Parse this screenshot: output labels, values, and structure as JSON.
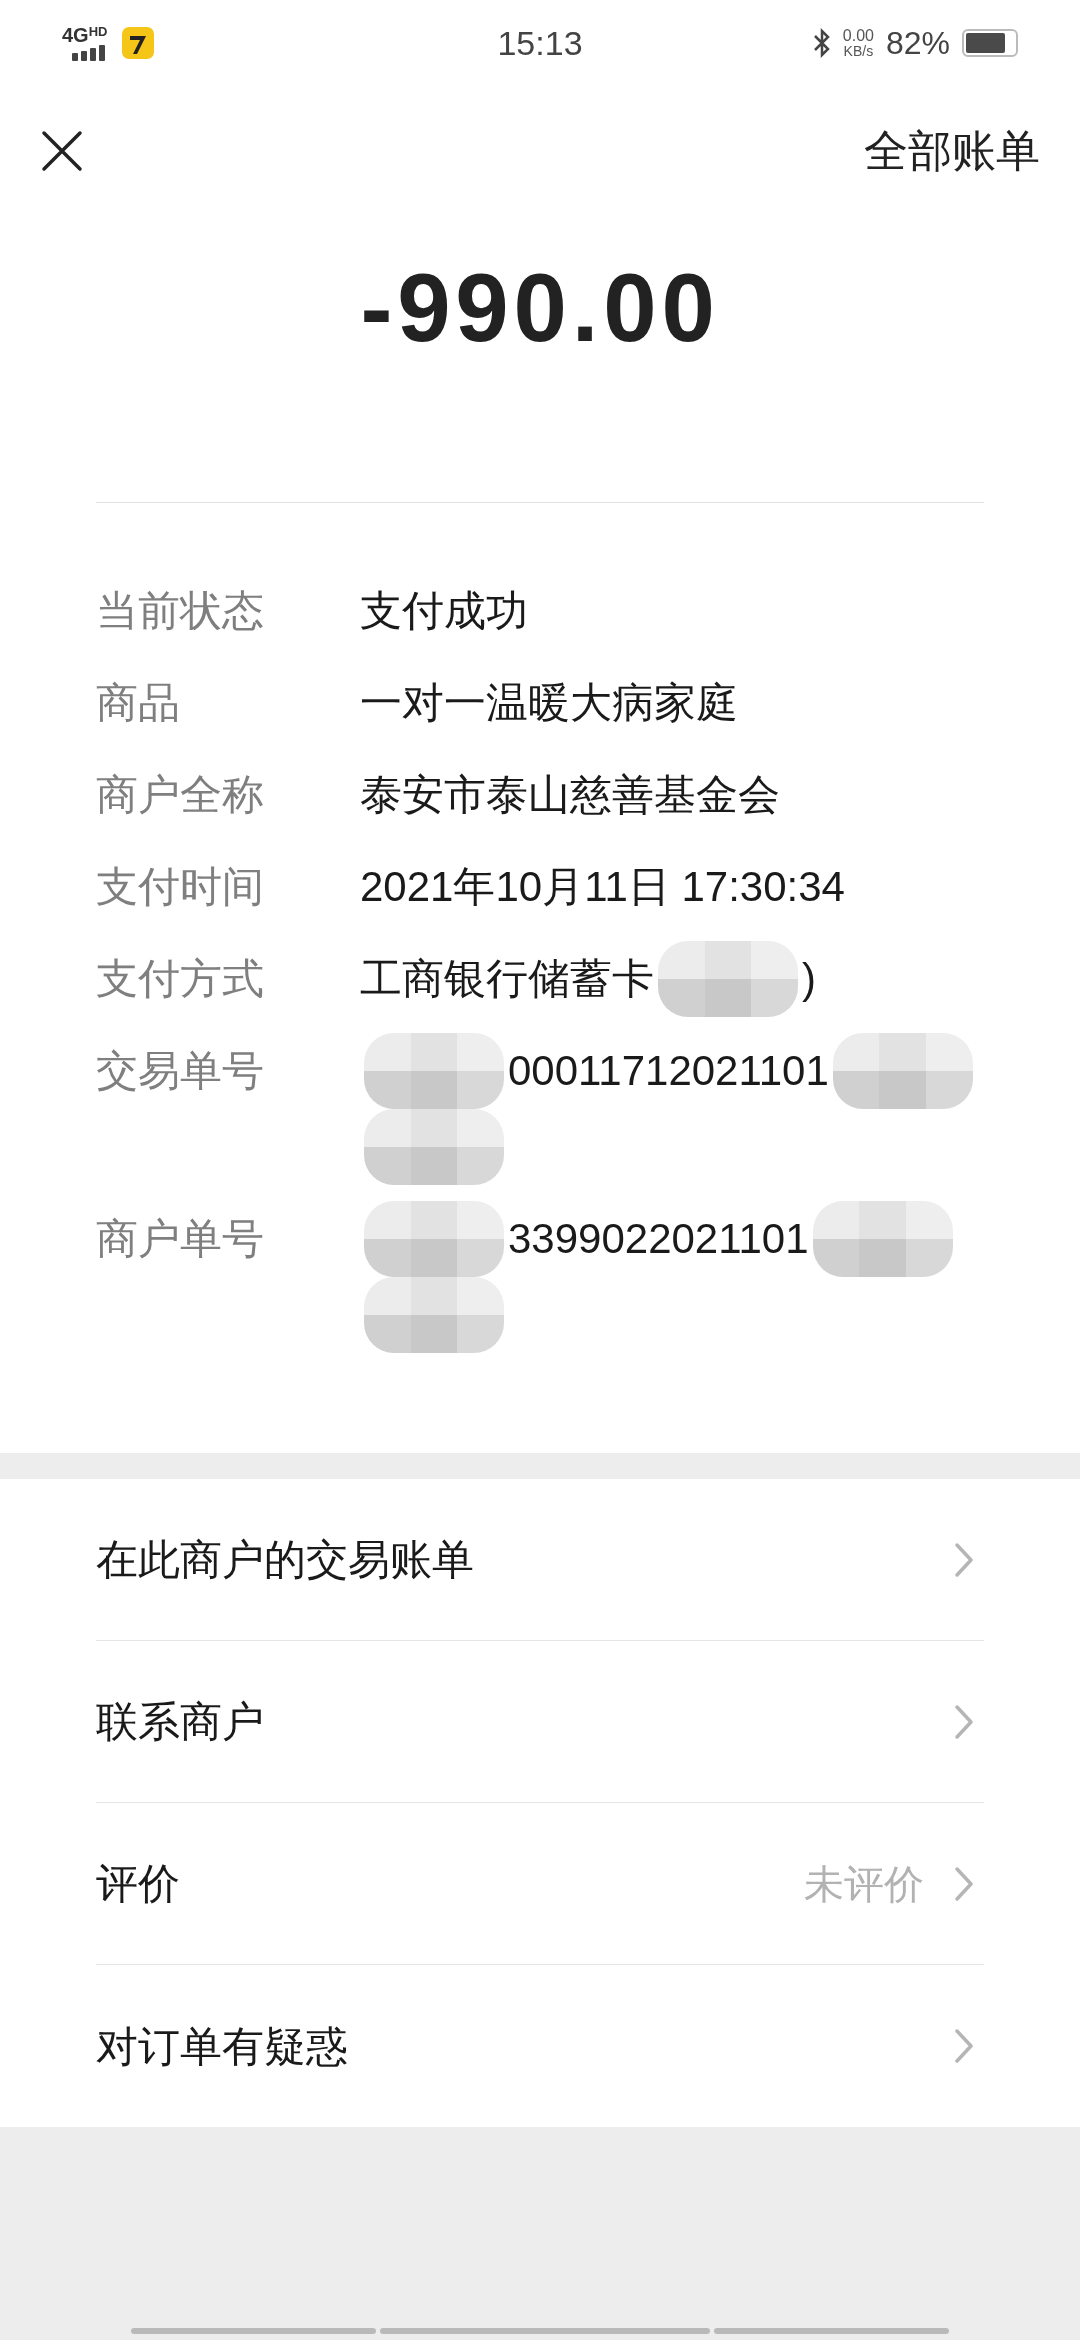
{
  "status_bar": {
    "network": "4G",
    "network_badge": "HD",
    "time": "15:13",
    "speed_value": "0.00",
    "speed_unit": "KB/s",
    "battery_text": "82%",
    "battery": {
      "level": 0.82
    }
  },
  "header": {
    "action": "全部账单"
  },
  "amount": "-990.00",
  "details": [
    {
      "label": "当前状态",
      "lines": [
        [
          {
            "kind": "text",
            "text": "支付成功"
          }
        ]
      ]
    },
    {
      "label": "商品",
      "lines": [
        [
          {
            "kind": "text",
            "text": "一对一温暖大病家庭"
          }
        ]
      ]
    },
    {
      "label": "商户全称",
      "lines": [
        [
          {
            "kind": "text",
            "text": "泰安市泰山慈善基金会"
          }
        ]
      ]
    },
    {
      "label": "支付时间",
      "lines": [
        [
          {
            "kind": "text",
            "text": "2021年10月11日 17:30:34"
          }
        ]
      ]
    },
    {
      "label": "支付方式",
      "lines": [
        [
          {
            "kind": "text",
            "text": "工商银行储蓄卡"
          },
          {
            "kind": "redacted"
          },
          {
            "kind": "text",
            "text": ")"
          }
        ]
      ]
    },
    {
      "label": "交易单号",
      "lines": [
        [
          {
            "kind": "redacted"
          },
          {
            "kind": "text",
            "text": "00011712021101"
          },
          {
            "kind": "redacted"
          }
        ],
        [
          {
            "kind": "redacted"
          }
        ]
      ]
    },
    {
      "label": "商户单号",
      "lines": [
        [
          {
            "kind": "redacted"
          },
          {
            "kind": "text",
            "text": "3399022021101"
          },
          {
            "kind": "redacted"
          }
        ],
        [
          {
            "kind": "redacted"
          }
        ]
      ]
    }
  ],
  "menu": [
    {
      "label": "在此商户的交易账单"
    },
    {
      "label": "联系商户"
    },
    {
      "label": "评价",
      "value": "未评价"
    },
    {
      "label": "对订单有疑惑"
    }
  ]
}
